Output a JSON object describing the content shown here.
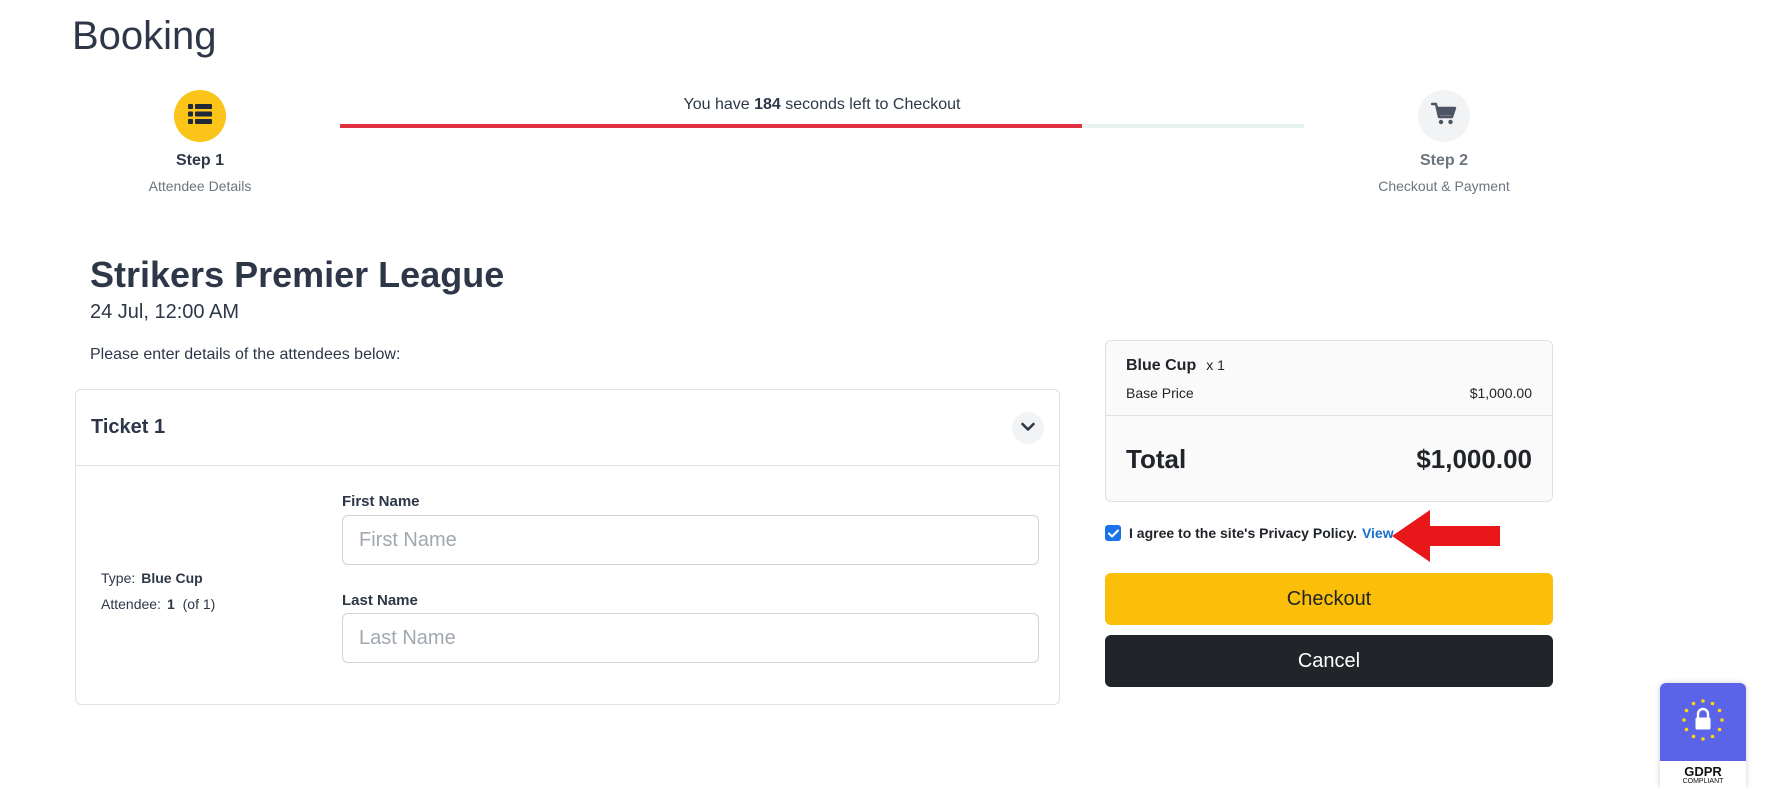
{
  "page": {
    "title": "Booking"
  },
  "steps": [
    {
      "title": "Step 1",
      "subtitle": "Attendee Details",
      "icon": "list-icon",
      "active": true
    },
    {
      "title": "Step 2",
      "subtitle": "Checkout & Payment",
      "icon": "cart-icon",
      "active": false
    }
  ],
  "timer": {
    "prefix": "You have",
    "seconds": "184",
    "suffix": "seconds left to Checkout",
    "progress_percent": 77,
    "colors": {
      "fill": "#e03141",
      "track": "#e6f2ee"
    }
  },
  "event": {
    "title": "Strikers Premier League",
    "date": "24 Jul, 12:00 AM",
    "intro": "Please enter details of the attendees below:"
  },
  "ticket": {
    "title": "Ticket 1",
    "type_label": "Type:",
    "type_value": "Blue Cup",
    "attendee_label": "Attendee:",
    "attendee_value": "1",
    "attendee_of": "(of 1)",
    "first_name_label": "First Name",
    "first_name_placeholder": "First Name",
    "last_name_label": "Last Name",
    "last_name_placeholder": "Last Name"
  },
  "summary": {
    "item_name": "Blue Cup",
    "item_qty": "x 1",
    "base_price_label": "Base Price",
    "base_price_value": "$1,000.00",
    "total_label": "Total",
    "total_value": "$1,000.00"
  },
  "agreement": {
    "checked": true,
    "text": "I agree to the site's Privacy Policy.",
    "link": "View"
  },
  "buttons": {
    "checkout": "Checkout",
    "cancel": "Cancel"
  },
  "gdpr": {
    "title": "GDPR",
    "subtitle": "COMPLIANT"
  },
  "colors": {
    "accent": "#fbbf0a",
    "dark": "#212529",
    "link": "#1a6fc9",
    "gdpr": "#5b63e8",
    "arrow": "#e8171a"
  }
}
